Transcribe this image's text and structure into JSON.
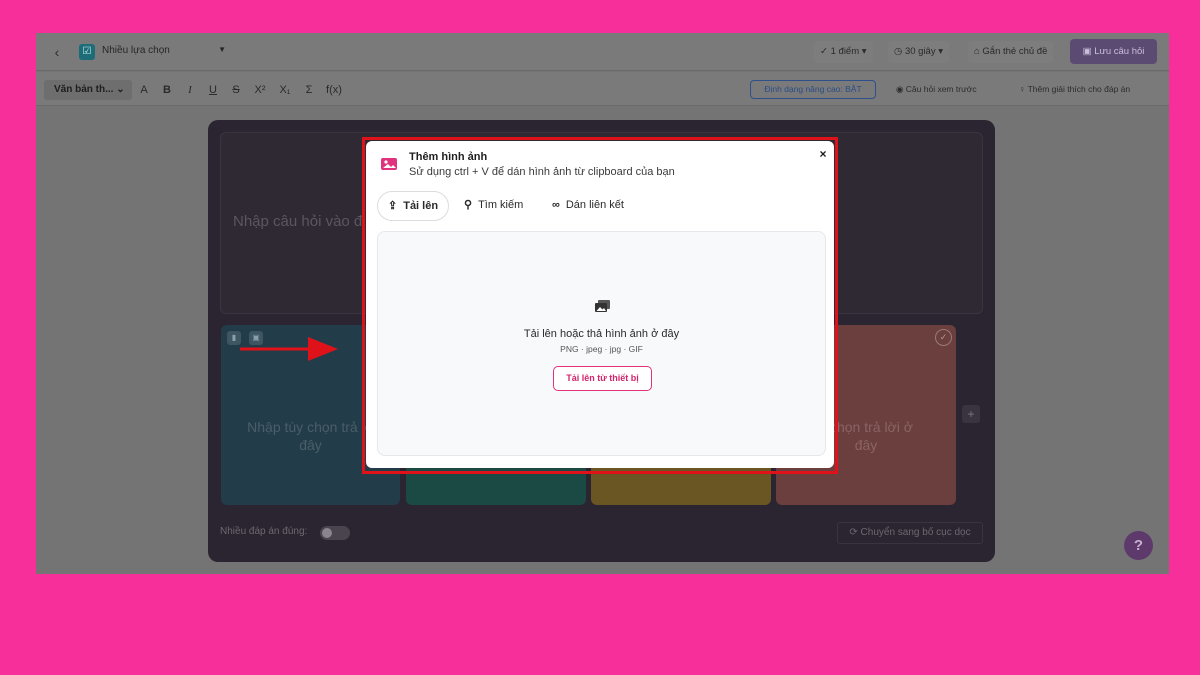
{
  "topbar": {
    "back_icon": "chevron-left-icon",
    "question_type": "Nhiều lựa chọn",
    "points": "1 điểm",
    "time": "30 giây",
    "tag_topic": "Gắn thẻ chủ đề",
    "save": "Lưu câu hỏi"
  },
  "toolbar": {
    "text_style": "Văn bản th...",
    "buttons": [
      "A",
      "B",
      "I",
      "U",
      "S",
      "X²",
      "X₁",
      "Σ",
      "f(x)"
    ],
    "advanced_format": "Định dạng nâng cao: BẬT",
    "preview": "Câu hỏi xem trước",
    "add_explanation": "Thêm giải thích cho đáp án"
  },
  "editor": {
    "question_placeholder": "Nhập câu hỏi vào đ",
    "option1_placeholder": "Nhập tùy chọn trả lờ đây",
    "option4_placeholder": "y chọn trả lời ở đây",
    "multi_correct": "Nhiều đáp án đúng:",
    "switch_layout": "Chuyển sang bố cục dọc",
    "help": "?"
  },
  "modal": {
    "title": "Thêm hình ảnh",
    "subtitle": "Sử dụng ctrl + V để dán hình ảnh từ clipboard của bạn",
    "close": "×",
    "tabs": [
      {
        "label": "Tải lên",
        "icon": "upload-icon",
        "active": true
      },
      {
        "label": "Tìm kiếm",
        "icon": "search-icon",
        "active": false
      },
      {
        "label": "Dán liên kết",
        "icon": "link-icon",
        "active": false
      }
    ],
    "drop_text": "Tải lên hoặc thả hình ảnh ở đây",
    "formats": "PNG · jpeg · jpg · GIF",
    "upload_button": "Tải lên từ thiết bị"
  },
  "colors": {
    "background": "#f72f9a",
    "highlight": "#e01219",
    "arrow": "#e01219",
    "accent": "#e0327d"
  }
}
